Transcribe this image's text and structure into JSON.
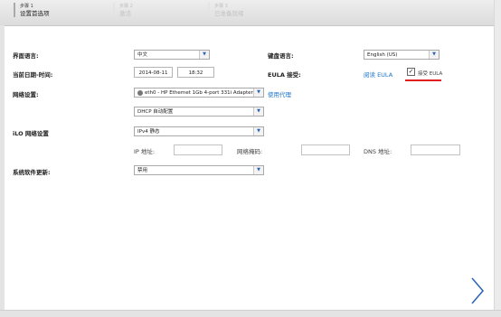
{
  "steps": [
    {
      "num": "步骤 1",
      "label": "设置首选项",
      "active": true
    },
    {
      "num": "步骤 2",
      "label": "激活",
      "active": false
    },
    {
      "num": "步骤 3",
      "label": "已准备就绪",
      "active": false
    }
  ],
  "form": {
    "interface_language_label": "界面语言:",
    "interface_language_value": "中文",
    "keyboard_language_label": "键盘语言:",
    "keyboard_language_value": "English (US)",
    "datetime_label": "当前日期-时间:",
    "date_value": "2014-08-11",
    "time_value": "18:32",
    "eula_label": "EULA 接受:",
    "eula_read_link": "阅读 EULA",
    "eula_accept_label": "接受 EULA",
    "network_label": "网络设置:",
    "network_adapter_value": "eth0 - HP Ethernet 1Gb 4-port 331i Adapter",
    "use_proxy_link": "使用代理",
    "dhcp_value": "DHCP 自动配置",
    "ilo_label": "iLO 网络设置",
    "ilo_value": "IPv4 静态",
    "ip_label": "IP 地址:",
    "mask_label": "网络掩码:",
    "dns_label": "DNS 地址:",
    "update_label": "系统软件更新:",
    "update_value": "禁用"
  },
  "colors": {
    "link": "#1a73c8",
    "accent": "#2a63b8",
    "highlight": "#e02020"
  },
  "icons": {
    "next": "chevron-right-icon",
    "dropdown": "chevron-down-icon",
    "checkbox": "checkbox-checked-icon",
    "network": "network-adapter-icon"
  }
}
